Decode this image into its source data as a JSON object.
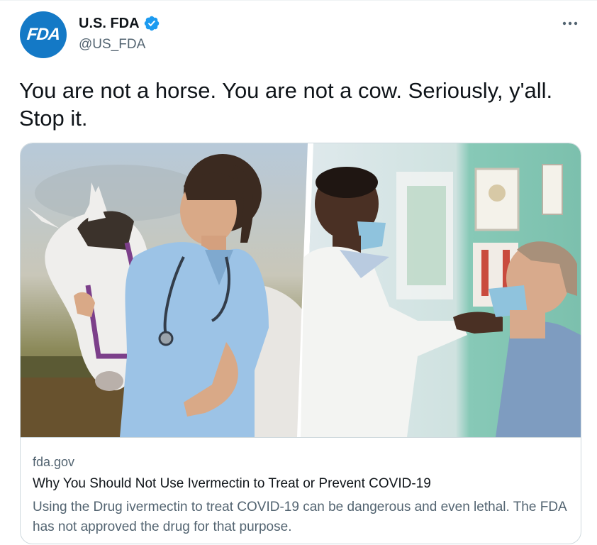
{
  "author": {
    "avatar_text": "FDA",
    "display_name": "U.S. FDA",
    "handle": "@US_FDA",
    "verified": true
  },
  "menu_icon": "more-horizontal-icon",
  "tweet_text": "You are not a horse. You are not a cow. Seriously, y'all. Stop it.",
  "card": {
    "domain": "fda.gov",
    "title": "Why You Should Not Use Ivermectin to Treat or Prevent COVID-19",
    "description": "Using the Drug ivermectin to treat COVID-19 can be dangerous and even lethal. The FDA has not approved the drug for that purpose.",
    "image_left": "veterinarian-with-horse-photo",
    "image_right": "doctor-examining-patient-photo"
  },
  "colors": {
    "brand_blue": "#1479c6",
    "verified_blue": "#1d9bf0",
    "text_primary": "#0f1419",
    "text_secondary": "#536471",
    "border": "#cfd9de"
  }
}
